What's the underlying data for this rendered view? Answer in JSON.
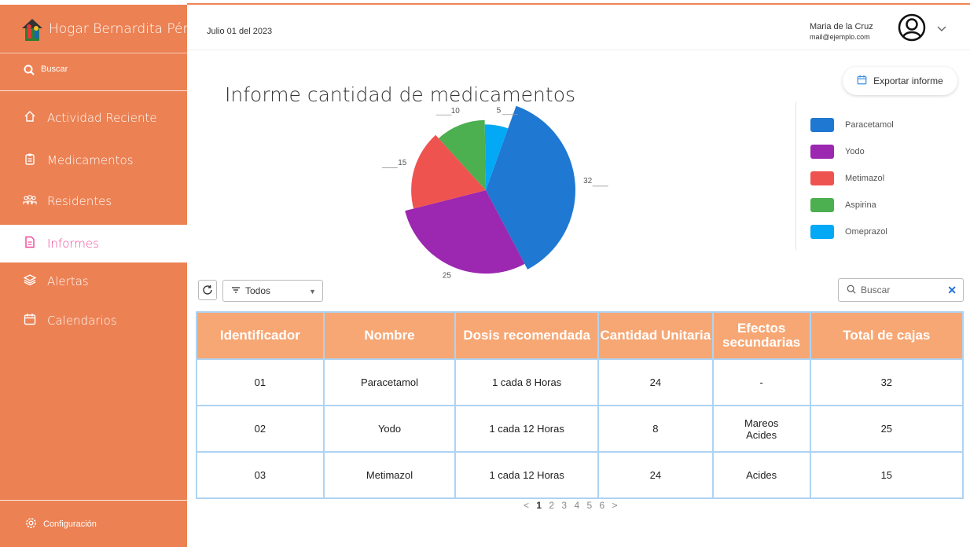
{
  "app": {
    "title": "Hogar Bernardita Pérez"
  },
  "sidebar": {
    "search_label": "Buscar",
    "items": [
      {
        "label": "Actividad Reciente",
        "icon": "home-icon"
      },
      {
        "label": "Medicamentos",
        "icon": "clipboard-icon"
      },
      {
        "label": "Residentes",
        "icon": "people-icon"
      },
      {
        "label": "Informes",
        "icon": "document-icon",
        "active": true
      },
      {
        "label": "Alertas",
        "icon": "layers-icon"
      },
      {
        "label": "Calendarios",
        "icon": "calendar-icon"
      }
    ],
    "config_label": "Configuración"
  },
  "header": {
    "date": "Julio 01 del 2023",
    "user_name": "Maria de la Cruz",
    "user_email": "mail@ejemplo.com"
  },
  "main": {
    "title": "Informe cantidad de medicamentos",
    "export_label": "Exportar informe"
  },
  "chart_data": {
    "type": "pie",
    "series": [
      {
        "name": "Paracetamol",
        "value": 32,
        "color": "#1f78d1"
      },
      {
        "name": "Yodo",
        "value": 25,
        "color": "#9c27b0"
      },
      {
        "name": "Metimazol",
        "value": 15,
        "color": "#ef5350"
      },
      {
        "name": "Aspirina",
        "value": 10,
        "color": "#4caf50"
      },
      {
        "name": "Omeprazol",
        "value": 5,
        "color": "#03a9f4"
      }
    ],
    "legend_position": "right"
  },
  "toolbar": {
    "filter_value": "Todos",
    "search_placeholder": "Buscar"
  },
  "table": {
    "headers": [
      "Identificador",
      "Nombre",
      "Dosis recomendada",
      "Cantidad Unitaria",
      "Efectos secundarias",
      "Total de cajas"
    ],
    "rows": [
      [
        "01",
        "Paracetamol",
        "1 cada 8 Horas",
        "24",
        "-",
        "32"
      ],
      [
        "02",
        "Yodo",
        "1 cada 12 Horas",
        "8",
        "Mareos Acides",
        "25"
      ],
      [
        "03",
        "Metimazol",
        "1 cada 12 Horas",
        "24",
        "Acides",
        "15"
      ]
    ]
  },
  "pagination": {
    "prev": "<",
    "pages": [
      "1",
      "2",
      "3",
      "4",
      "5",
      "6"
    ],
    "current": "1",
    "next": ">"
  }
}
